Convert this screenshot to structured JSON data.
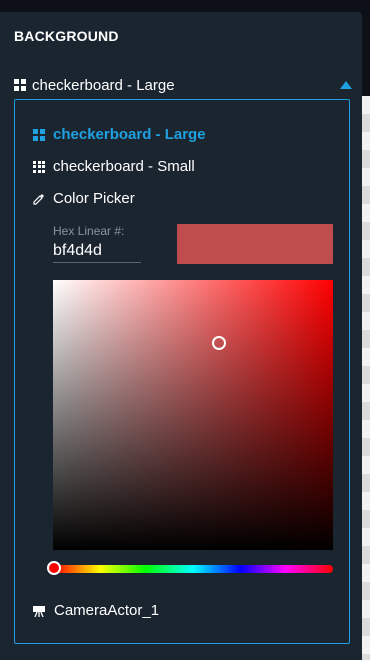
{
  "section": {
    "title": "BACKGROUND"
  },
  "dropdown": {
    "selected_label": "checkerboard - Large",
    "items": [
      {
        "label": "checkerboard - Large",
        "selected": true
      },
      {
        "label": "checkerboard - Small",
        "selected": false
      },
      {
        "label": "Color Picker",
        "selected": false
      },
      {
        "label": "CameraActor_1",
        "selected": false
      }
    ]
  },
  "color_picker": {
    "hex_label": "Hex Linear #:",
    "hex_value": "bf4d4d",
    "swatch_color": "#bf4d4d",
    "hue_color": "#ff0000"
  },
  "colors": {
    "accent": "#1fa0e0",
    "panel": "#1b2530",
    "text": "#ffffff",
    "muted": "#8a94a0"
  },
  "icons": {
    "header": "checkerboard-large-icon",
    "item_large": "checkerboard-large-icon",
    "item_small": "checkerboard-small-icon",
    "item_picker": "eyedropper-icon",
    "item_camera": "camera-icon",
    "caret": "caret-up-icon"
  }
}
